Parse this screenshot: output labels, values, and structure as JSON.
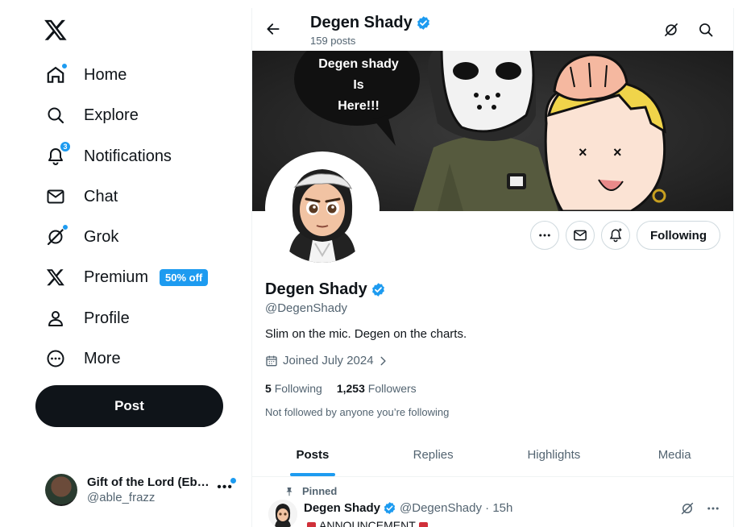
{
  "sidebar": {
    "logo_icon": "x-logo-icon",
    "items": [
      {
        "label": "Home",
        "icon": "home-icon",
        "dot": true
      },
      {
        "label": "Explore",
        "icon": "search-icon"
      },
      {
        "label": "Notifications",
        "icon": "bell-icon",
        "badge": "3"
      },
      {
        "label": "Chat",
        "icon": "mail-icon"
      },
      {
        "label": "Grok",
        "icon": "grok-icon",
        "dot": true
      },
      {
        "label": "Premium",
        "icon": "x-logo-icon",
        "promo": "50% off"
      },
      {
        "label": "Profile",
        "icon": "person-icon"
      },
      {
        "label": "More",
        "icon": "more-circle-icon"
      }
    ],
    "post_label": "Post",
    "account": {
      "name": "Gift of the Lord (Eb…",
      "handle": "@able_frazz",
      "more": "•••"
    }
  },
  "header": {
    "name": "Degen Shady",
    "posts_count": "159 posts"
  },
  "banner": {
    "speech": [
      "Degen shady",
      "Is",
      "Here!!!"
    ]
  },
  "profile": {
    "name": "Degen Shady",
    "handle": "@DegenShady",
    "bio": "Slim on the mic. Degen on the charts.",
    "joined": "Joined July 2024",
    "following_count": "5",
    "following_label": "Following",
    "followers_count": "1,253",
    "followers_label": "Followers",
    "note": "Not followed by anyone you’re following",
    "following_button": "Following"
  },
  "tabs": [
    "Posts",
    "Replies",
    "Highlights",
    "Media"
  ],
  "pinned_tweet": {
    "pinned_label": "Pinned",
    "name": "Degen Shady",
    "handle_time": "@DegenShady · 15h",
    "body": "ANNOUNCEMENT"
  },
  "colors": {
    "accent": "#1d9bf0",
    "text": "#0f1419",
    "muted": "#536471",
    "post_button": "#0f1419"
  }
}
